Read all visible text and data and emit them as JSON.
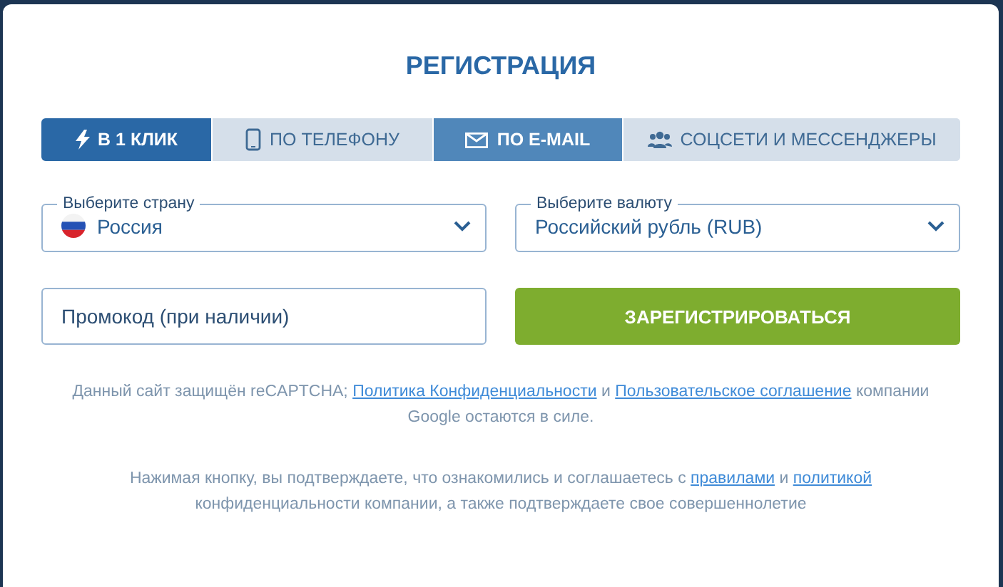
{
  "title": "РЕГИСТРАЦИЯ",
  "tabs": [
    {
      "label": "В 1 КЛИК",
      "selected": true,
      "hovered": false
    },
    {
      "label": "ПО ТЕЛЕФОНУ",
      "selected": false,
      "hovered": false
    },
    {
      "label": "ПО E-MAIL",
      "selected": false,
      "hovered": true
    },
    {
      "label": "СОЦСЕТИ И МЕССЕНДЖЕРЫ",
      "selected": false,
      "hovered": false
    }
  ],
  "country": {
    "label": "Выберите страну",
    "value": "Россия"
  },
  "currency": {
    "label": "Выберите валюту",
    "value": "Российский рубль (RUB)"
  },
  "promo": {
    "placeholder": "Промокод (при наличии)"
  },
  "register_button": "ЗАРЕГИСТРИРОВАТЬСЯ",
  "notices": [
    {
      "parts": [
        {
          "kind": "text",
          "text": "Данный сайт защищён reCAPTCHA; "
        },
        {
          "kind": "link",
          "text": "Политика Конфиденциальности"
        },
        {
          "kind": "text",
          "text": " и "
        },
        {
          "kind": "link",
          "text": "Пользовательское соглашение"
        },
        {
          "kind": "text",
          "text": " компании Google остаются в силе."
        }
      ]
    },
    {
      "parts": [
        {
          "kind": "text",
          "text": "Нажимая кнопку, вы подтверждаете, что ознакомились и соглашаетесь с "
        },
        {
          "kind": "link",
          "text": "правилами"
        },
        {
          "kind": "text",
          "text": " и "
        },
        {
          "kind": "link",
          "text": "политикой"
        },
        {
          "kind": "text",
          "text": " конфиденциальности компании, а также подтверждаете свое совершеннолетие"
        }
      ]
    }
  ]
}
